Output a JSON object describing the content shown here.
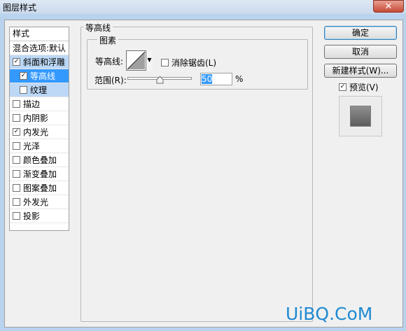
{
  "window": {
    "title": "图层样式",
    "close_icon": "close-icon"
  },
  "left_panel": {
    "header": "样式",
    "items": [
      {
        "label": "混合选项:默认",
        "checkbox": false,
        "checked": false,
        "state": "normal",
        "indent": false
      },
      {
        "label": "斜面和浮雕",
        "checkbox": true,
        "checked": true,
        "state": "selected",
        "indent": false
      },
      {
        "label": "等高线",
        "checkbox": true,
        "checked": true,
        "state": "active",
        "indent": true
      },
      {
        "label": "纹理",
        "checkbox": true,
        "checked": false,
        "state": "selected",
        "indent": true
      },
      {
        "label": "描边",
        "checkbox": true,
        "checked": false,
        "state": "normal",
        "indent": false
      },
      {
        "label": "内阴影",
        "checkbox": true,
        "checked": false,
        "state": "normal",
        "indent": false
      },
      {
        "label": "内发光",
        "checkbox": true,
        "checked": true,
        "state": "normal",
        "indent": false
      },
      {
        "label": "光泽",
        "checkbox": true,
        "checked": false,
        "state": "normal",
        "indent": false
      },
      {
        "label": "颜色叠加",
        "checkbox": true,
        "checked": false,
        "state": "normal",
        "indent": false
      },
      {
        "label": "渐变叠加",
        "checkbox": true,
        "checked": false,
        "state": "normal",
        "indent": false
      },
      {
        "label": "图案叠加",
        "checkbox": true,
        "checked": false,
        "state": "normal",
        "indent": false
      },
      {
        "label": "外发光",
        "checkbox": true,
        "checked": false,
        "state": "normal",
        "indent": false
      },
      {
        "label": "投影",
        "checkbox": true,
        "checked": false,
        "state": "normal",
        "indent": false
      }
    ]
  },
  "contour_group": {
    "title": "等高线",
    "pixels_group": {
      "title": "图素",
      "contour_label": "等高线:",
      "antialias_label": "消除锯齿(L)",
      "antialias_checked": false,
      "range_label": "范围(R):",
      "range_value": "50",
      "range_unit": "%",
      "range_fraction": 0.5
    }
  },
  "buttons": {
    "ok": "确定",
    "cancel": "取消",
    "new_style": "新建样式(W)...",
    "preview_label": "预览(V)",
    "preview_checked": true
  },
  "watermark": "UiBQ.CoM",
  "colors": {
    "selection": "#3399ff",
    "selection_light": "#bcd8f6",
    "watermark": "#1f8ad2"
  }
}
